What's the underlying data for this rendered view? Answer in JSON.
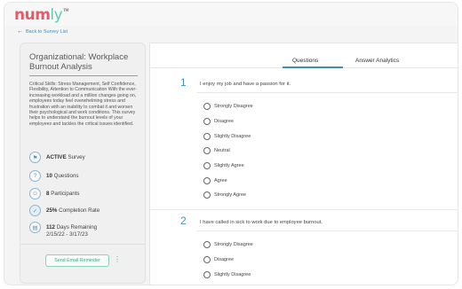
{
  "app": {
    "logo_main": "num",
    "logo_accent": "ly",
    "logo_tm": "TM"
  },
  "nav": {
    "back_label": "Back to Survey List"
  },
  "survey": {
    "title": "Organizational: Workplace Burnout Analysis",
    "description": "Critical Skills: Stress Management, Self Confidence, Flexibility, Attention to Communication With the ever-increasing workload and a million changes going on, employees today feel overwhelming stress and frustration with an inability to combat it and worsen their psychological and work conditions. This survey helps to understand the burnout levels of your employees and tackles the critical issues identified.",
    "stats": {
      "status_value": "ACTIVE",
      "status_label": "Survey",
      "questions_value": "10",
      "questions_label": "Questions",
      "participants_value": "8",
      "participants_label": "Participants",
      "completion_value": "25%",
      "completion_label": "Completion Rate",
      "days_value": "112",
      "days_label": "Days Remaining",
      "date_range": "2/15/22 - 3/17/23"
    },
    "reminder_button": "Send Email Reminder",
    "kebab": "⋮"
  },
  "tabs": {
    "questions": "Questions",
    "analytics": "Answer Analytics"
  },
  "questions": [
    {
      "number": "1",
      "text": "I enjoy my job and have a passion for it.",
      "options": [
        "Strongly Disagree",
        "Disagree",
        "Slightly Disagree",
        "Neutral",
        "Slightly Agree",
        "Agree",
        "Strongly Agree"
      ]
    },
    {
      "number": "2",
      "text": "I have called in sick to work due to employee burnout.",
      "options": [
        "Strongly Disagree",
        "Disagree",
        "Slightly Disagree"
      ]
    }
  ],
  "colors": {
    "brand_red": "#e85a63",
    "brand_teal": "#60c9b4",
    "accent_blue": "#3f8fae",
    "button_green": "#3fa883"
  },
  "icons": {
    "back": "arrow-left-icon",
    "status": "flag-icon",
    "questions": "question-icon",
    "participants": "people-icon",
    "completion": "check-icon",
    "days": "calendar-icon"
  }
}
